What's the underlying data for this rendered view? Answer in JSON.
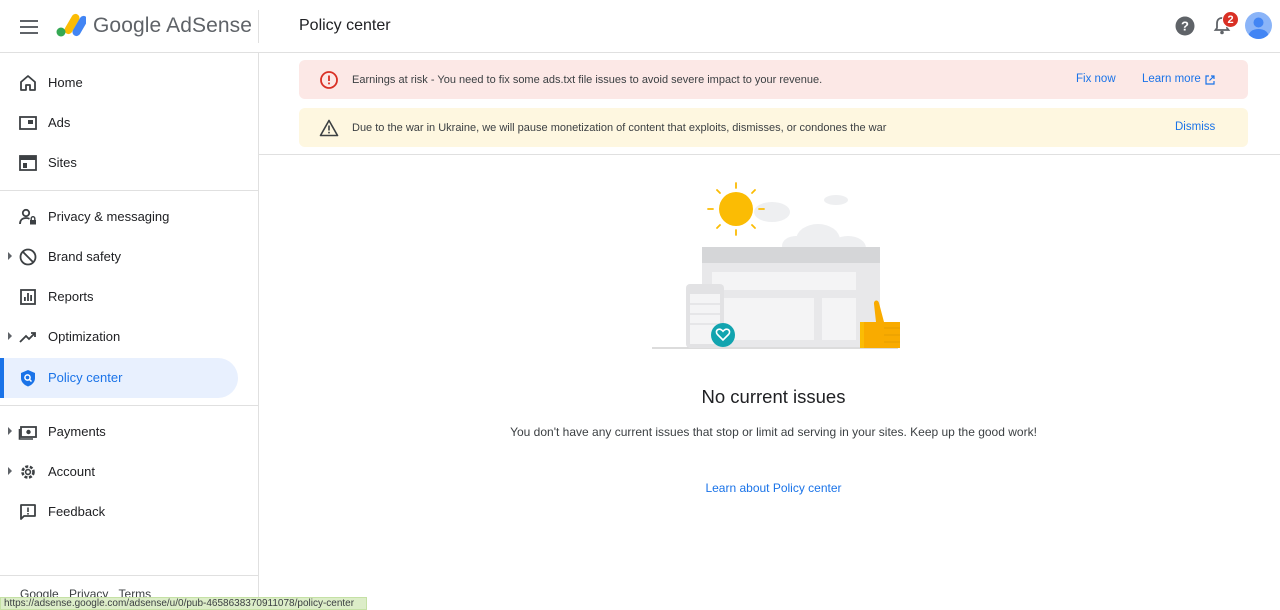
{
  "header": {
    "brand": "Google AdSense",
    "page_title": "Policy center",
    "notification_count": "2"
  },
  "sidebar": {
    "items": [
      {
        "label": "Home",
        "icon": "home-icon"
      },
      {
        "label": "Ads",
        "icon": "ads-icon"
      },
      {
        "label": "Sites",
        "icon": "sites-icon"
      },
      {
        "label": "Privacy & messaging",
        "icon": "privacy-icon"
      },
      {
        "label": "Brand safety",
        "icon": "brand-safety-icon"
      },
      {
        "label": "Reports",
        "icon": "reports-icon"
      },
      {
        "label": "Optimization",
        "icon": "optimization-icon"
      },
      {
        "label": "Policy center",
        "icon": "policy-shield-icon"
      },
      {
        "label": "Payments",
        "icon": "payments-icon"
      },
      {
        "label": "Account",
        "icon": "gear-icon"
      },
      {
        "label": "Feedback",
        "icon": "feedback-icon"
      }
    ],
    "footer": [
      "Google",
      "Privacy",
      "Terms"
    ]
  },
  "alerts": {
    "earnings": {
      "text": "Earnings at risk - You need to fix some ads.txt file issues to avoid severe impact to your revenue.",
      "fix_label": "Fix now",
      "learn_label": "Learn more"
    },
    "ukraine": {
      "text": "Due to the war in Ukraine, we will pause monetization of content that exploits, dismisses, or condones the war",
      "dismiss_label": "Dismiss"
    }
  },
  "main": {
    "title": "No current issues",
    "description": "You don't have any current issues that stop or limit ad serving in your sites. Keep up the good work!",
    "learn_link": "Learn about Policy center"
  },
  "status_url": "https://adsense.google.com/adsense/u/0/pub-4658638370911078/policy-center",
  "colors": {
    "accent": "#1a73e8",
    "error": "#d93025",
    "warning_bg": "#fef7e0",
    "error_bg": "#fce8e6"
  }
}
